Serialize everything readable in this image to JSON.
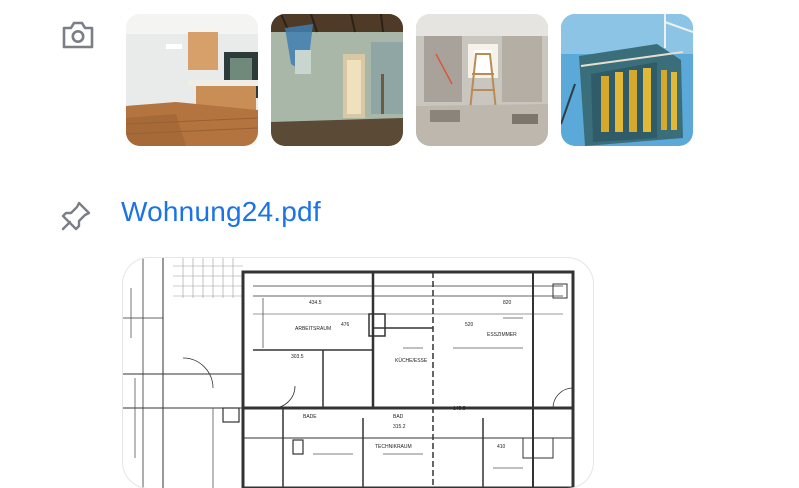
{
  "attachments": {
    "photos_icon": "camera-icon",
    "photos": [
      {
        "name": "photo-interior-kitchen"
      },
      {
        "name": "photo-renovation-room"
      },
      {
        "name": "photo-construction-site-interior"
      },
      {
        "name": "photo-building-scaffolding"
      }
    ],
    "file_icon": "pin-icon",
    "file_name": "Wohnung24.pdf"
  },
  "floor_plan": {
    "room_labels": [
      "ARBEITSRAUM",
      "KÜCHE/ESSE",
      "ESSZIMMER",
      "BADE",
      "BAD",
      "TECHNIKRAUM"
    ],
    "dimension_labels": [
      "434.5",
      "476",
      "520",
      "303.5",
      "820",
      "145.5",
      "315.2",
      "410"
    ]
  },
  "colors": {
    "link": "#1a73e8",
    "icon": "#7a7f87"
  }
}
